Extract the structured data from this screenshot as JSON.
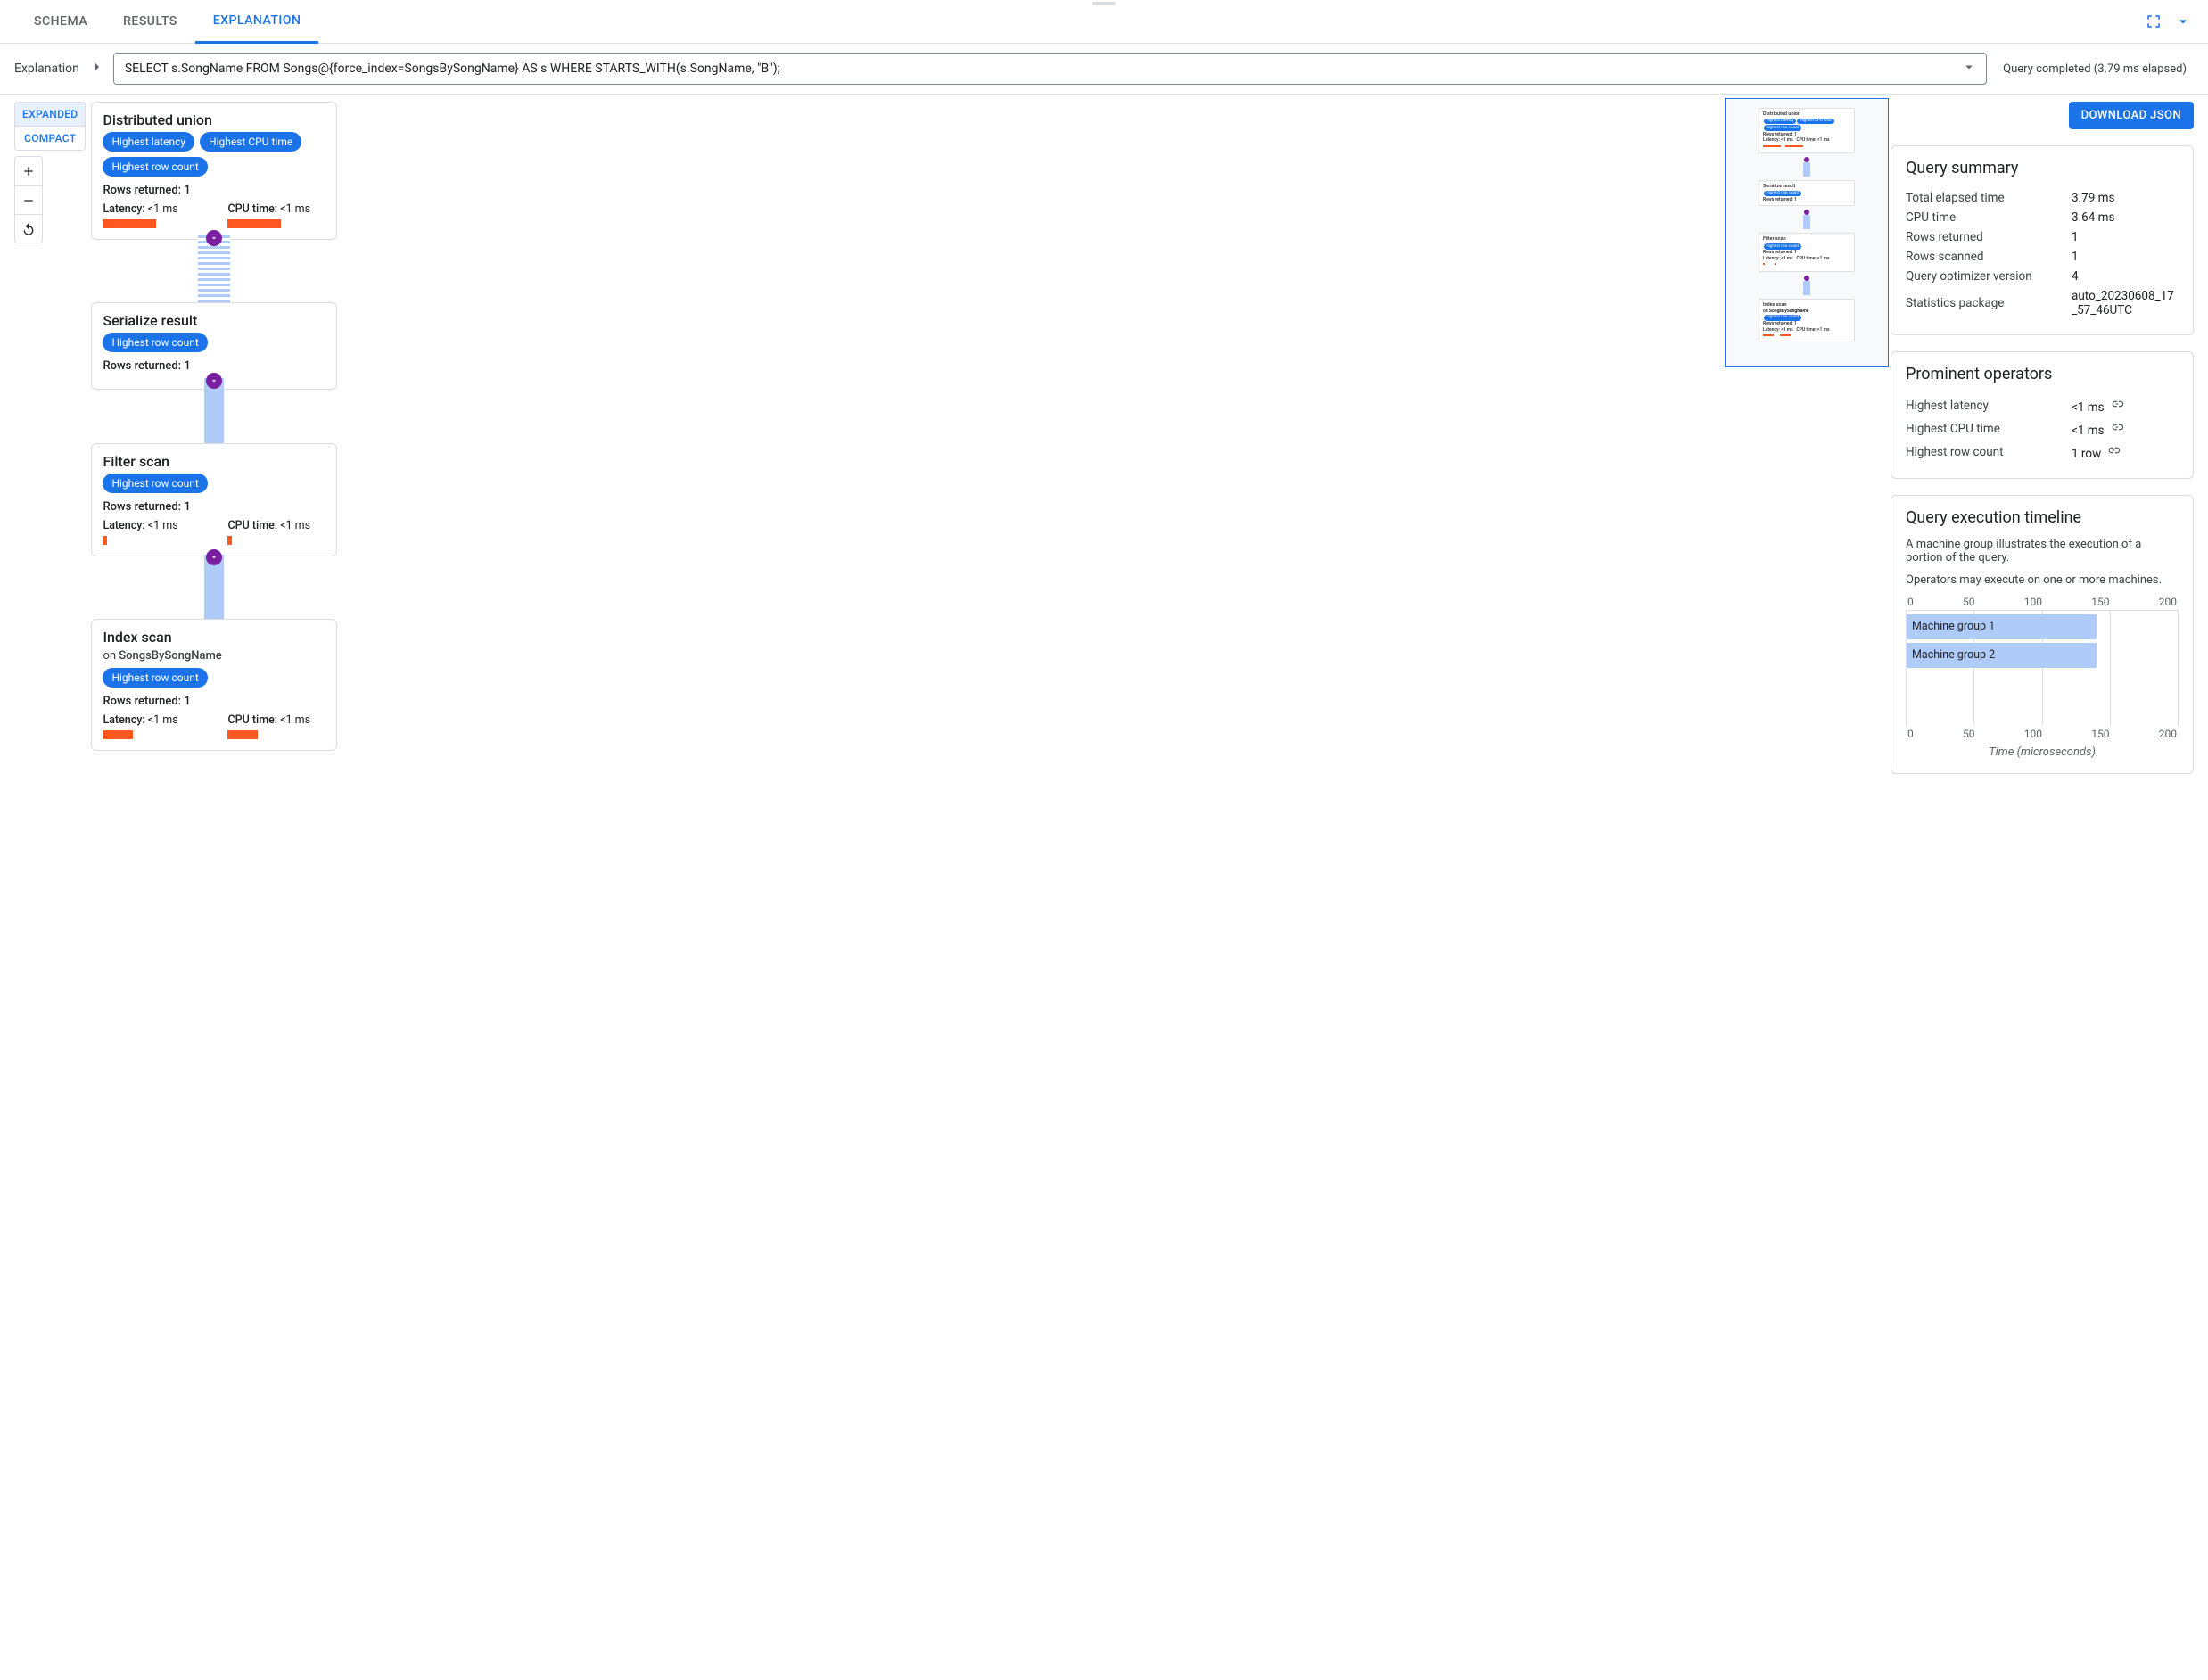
{
  "tabs": {
    "schema": "SCHEMA",
    "results": "RESULTS",
    "explanation": "EXPLANATION"
  },
  "breadcrumb": {
    "label": "Explanation",
    "query": "SELECT s.SongName FROM Songs@{force_index=SongsBySongName} AS s WHERE STARTS_WITH(s.SongName, \"B\");"
  },
  "status": "Query completed (3.79 ms elapsed)",
  "modes": {
    "expanded": "EXPANDED",
    "compact": "COMPACT"
  },
  "download_button": "DOWNLOAD JSON",
  "nodes": {
    "n0": {
      "title": "Distributed union",
      "chips": [
        "Highest latency",
        "Highest CPU time",
        "Highest row count"
      ],
      "rows": "Rows returned: 1",
      "lat_label": "Latency: ",
      "lat_val": "<1 ms",
      "lat_bar_pct": 74,
      "cpu_label": "CPU time: ",
      "cpu_val": "<1 ms",
      "cpu_bar_pct": 74
    },
    "n1": {
      "title": "Serialize result",
      "chips": [
        "Highest row count"
      ],
      "rows": "Rows returned: 1"
    },
    "n2": {
      "title": "Filter scan",
      "chips": [
        "Highest row count"
      ],
      "rows": "Rows returned: 1",
      "lat_label": "Latency: ",
      "lat_val": "<1 ms",
      "lat_bar_pct": 6,
      "cpu_label": "CPU time: ",
      "cpu_val": "<1 ms",
      "cpu_bar_pct": 6
    },
    "n3": {
      "title": "Index scan",
      "sub_prefix": "on ",
      "sub": "SongsBySongName",
      "chips": [
        "Highest row count"
      ],
      "rows": "Rows returned: 1",
      "lat_label": "Latency: ",
      "lat_val": "<1 ms",
      "lat_bar_pct": 42,
      "cpu_label": "CPU time: ",
      "cpu_val": "<1 ms",
      "cpu_bar_pct": 42
    }
  },
  "summary": {
    "title": "Query summary",
    "rows": {
      "elapsed_k": "Total elapsed time",
      "elapsed_v": "3.79 ms",
      "cpu_k": "CPU time",
      "cpu_v": "3.64 ms",
      "ret_k": "Rows returned",
      "ret_v": "1",
      "scan_k": "Rows scanned",
      "scan_v": "1",
      "opt_k": "Query optimizer version",
      "opt_v": "4",
      "stats_k": "Statistics package",
      "stats_v": "auto_20230608_17_57_46UTC"
    }
  },
  "prominent": {
    "title": "Prominent operators",
    "rows": {
      "lat_k": "Highest latency",
      "lat_v": "<1 ms",
      "cpu_k": "Highest CPU time",
      "cpu_v": "<1 ms",
      "row_k": "Highest row count",
      "row_v": "1 row"
    }
  },
  "timeline": {
    "title": "Query execution timeline",
    "desc1": "A machine group illustrates the execution of a portion of the query.",
    "desc2": "Operators may execute on one or more machines.",
    "ticks": [
      "0",
      "50",
      "100",
      "150",
      "200"
    ],
    "bars": {
      "b0": "Machine group 1",
      "b1": "Machine group 2"
    },
    "xlabel": "Time (microseconds)"
  },
  "chart_data": {
    "type": "bar",
    "orientation": "horizontal",
    "title": "Query execution timeline",
    "xlabel": "Time (microseconds)",
    "xlim": [
      0,
      200
    ],
    "categories": [
      "Machine group 1",
      "Machine group 2"
    ],
    "values": [
      140,
      140
    ]
  }
}
